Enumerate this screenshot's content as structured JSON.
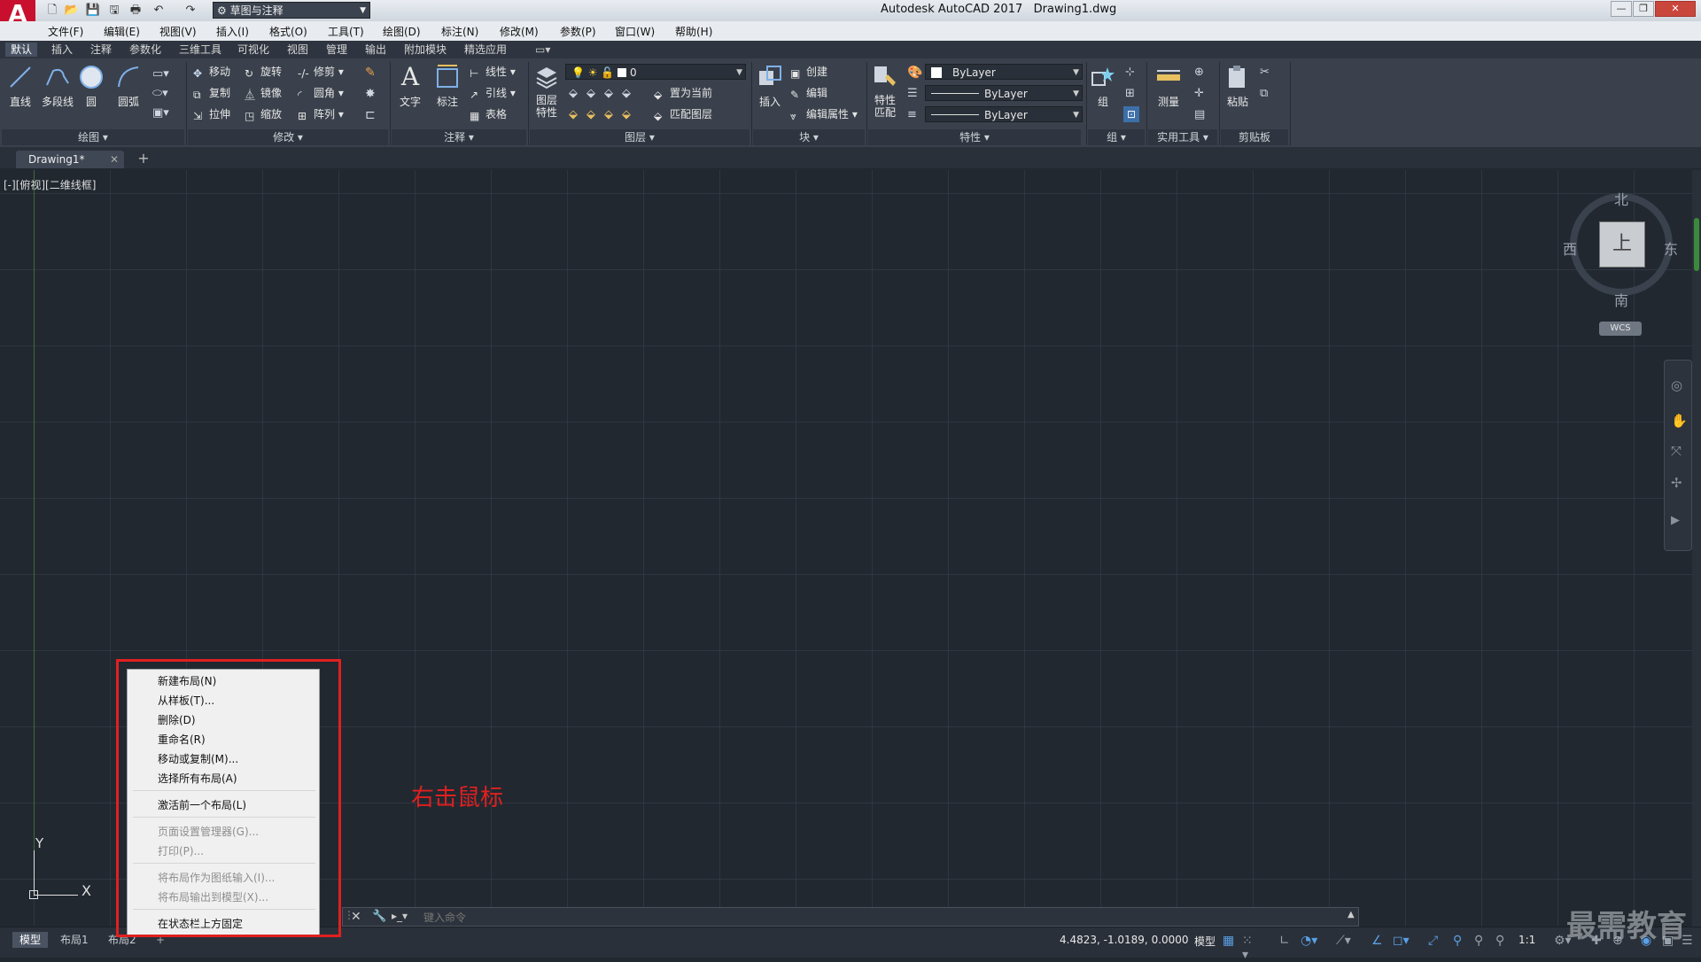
{
  "window": {
    "app_title": "Autodesk AutoCAD 2017",
    "file_name": "Drawing1.dwg",
    "workspace": "草图与注释"
  },
  "menu": [
    "文件(F)",
    "编辑(E)",
    "视图(V)",
    "插入(I)",
    "格式(O)",
    "工具(T)",
    "绘图(D)",
    "标注(N)",
    "修改(M)",
    "参数(P)",
    "窗口(W)",
    "帮助(H)"
  ],
  "ribbon_tabs": [
    "默认",
    "插入",
    "注释",
    "参数化",
    "三维工具",
    "可视化",
    "视图",
    "管理",
    "输出",
    "附加模块",
    "精选应用"
  ],
  "ribbon": {
    "draw": {
      "line": "直线",
      "polyline": "多段线",
      "circle": "圆",
      "arc": "圆弧",
      "footer": "绘图 ▾"
    },
    "modify": {
      "move": "移动",
      "rotate": "旋转",
      "trim": "修剪",
      "copy": "复制",
      "mirror": "镜像",
      "fillet": "圆角",
      "stretch": "拉伸",
      "scale": "缩放",
      "array": "阵列",
      "footer": "修改 ▾"
    },
    "annotation": {
      "text": "文字",
      "dimension": "标注",
      "linear": "线性",
      "leader": "引线",
      "table": "表格",
      "footer": "注释 ▾"
    },
    "layers": {
      "layer_props": "图层特性",
      "layer_name": "0",
      "set_current": "置为当前",
      "match_layer": "匹配图层",
      "footer": "图层 ▾"
    },
    "block": {
      "insert": "插入",
      "create": "创建",
      "edit": "编辑",
      "edit_attr": "编辑属性",
      "footer": "块 ▾"
    },
    "properties": {
      "match": "特性匹配",
      "color": "ByLayer",
      "linetype": "ByLayer",
      "lineweight": "ByLayer",
      "footer": "特性 ▾"
    },
    "groups": {
      "group": "组",
      "footer": "组 ▾"
    },
    "utilities": {
      "measure": "测量",
      "footer": "实用工具 ▾"
    },
    "clipboard": {
      "paste": "粘贴",
      "footer": "剪贴板"
    }
  },
  "file_tab": "Drawing1*",
  "viewport_label": "[-][俯视][二维线框]",
  "viewcube": {
    "top": "上",
    "north": "北",
    "south": "南",
    "east": "东",
    "west": "西",
    "wcs": "WCS"
  },
  "ucs": {
    "x": "X",
    "y": "Y"
  },
  "context_menu": {
    "items": [
      "新建布局(N)",
      "从样板(T)...",
      "删除(D)",
      "重命名(R)",
      "移动或复制(M)...",
      "选择所有布局(A)",
      "激活前一个布局(L)",
      "页面设置管理器(G)...",
      "打印(P)...",
      "将布局作为图纸输入(I)...",
      "将布局输出到模型(X)...",
      "在状态栏上方固定"
    ]
  },
  "annotation_text": "右击鼠标",
  "command": {
    "placeholder": "键入命令"
  },
  "layout_tabs": [
    "模型",
    "布局1",
    "布局2"
  ],
  "status": {
    "coords": "4.4823, -1.0189, 0.0000",
    "model": "模型",
    "scale": "1:1"
  },
  "watermark": "最需教育"
}
